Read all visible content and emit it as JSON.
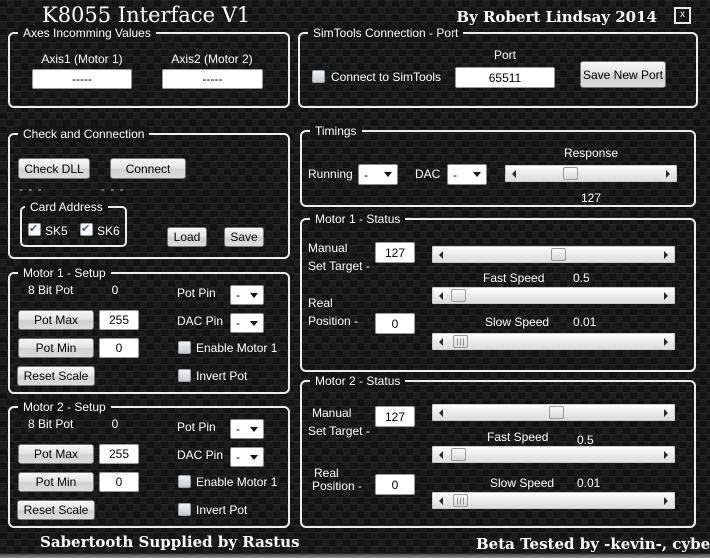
{
  "window": {
    "title": "K8055 Interface V1",
    "byline": "By Robert Lindsay 2014",
    "close": "x"
  },
  "axes": {
    "title": "Axes Incomming Values",
    "axis1_label": "Axis1 (Motor 1)",
    "axis1_value": "-----",
    "axis2_label": "Axis2 (Motor 2)",
    "axis2_value": "-----"
  },
  "simtools": {
    "title": "SimTools Connection - Port",
    "connect_label": "Connect to SimTools",
    "connect_checked": false,
    "port_label": "Port",
    "port_value": "65511",
    "save_button": "Save New Port"
  },
  "check": {
    "title": "Check and Connection",
    "check_dll_button": "Check DLL",
    "connect_button": "Connect",
    "status_left": "- - -",
    "status_right": "- - -",
    "card": {
      "title": "Card Address",
      "sk5_label": "SK5",
      "sk5_checked": true,
      "sk6_label": "SK6",
      "sk6_checked": true
    },
    "load_button": "Load",
    "save_button": "Save"
  },
  "timings": {
    "title": "Timings",
    "running_label": "Running",
    "running_value": "-",
    "dac_label": "DAC",
    "dac_value": "-",
    "response_label": "Response",
    "response_value": "127"
  },
  "motor1_setup": {
    "title": "Motor 1 - Setup",
    "bit_pot_label": "8 Bit Pot",
    "bit_pot_value": "0",
    "pot_pin_label": "Pot Pin",
    "pot_pin_value": "-",
    "pot_max_button": "Pot Max",
    "pot_max_value": "255",
    "dac_pin_label": "DAC Pin",
    "dac_pin_value": "-",
    "pot_min_button": "Pot Min",
    "pot_min_value": "0",
    "enable_label": "Enable Motor 1",
    "enable_checked": false,
    "reset_button": "Reset Scale",
    "invert_label": "Invert Pot",
    "invert_checked": false
  },
  "motor2_setup": {
    "title": "Motor 2 - Setup",
    "bit_pot_label": "8 Bit Pot",
    "bit_pot_value": "0",
    "pot_pin_label": "Pot Pin",
    "pot_pin_value": "-",
    "pot_max_button": "Pot Max",
    "pot_max_value": "255",
    "dac_pin_label": "DAC Pin",
    "dac_pin_value": "-",
    "pot_min_button": "Pot Min",
    "pot_min_value": "0",
    "enable_label": "Enable Motor 1",
    "enable_checked": false,
    "reset_button": "Reset Scale",
    "invert_label": "Invert Pot",
    "invert_checked": false
  },
  "motor1_status": {
    "title": "Motor 1 - Status",
    "manual_label_line1": "Manual",
    "manual_label_line2": "Set Target -",
    "manual_value": "127",
    "fast_speed_label": "Fast Speed",
    "fast_speed_value": "0.5",
    "real_label_line1": "Real",
    "real_label_line2": "Position -",
    "real_value": "0",
    "slow_speed_label": "Slow Speed",
    "slow_speed_value": "0.01"
  },
  "motor2_status": {
    "title": "Motor 2 - Status",
    "manual_label_line1": "Manual",
    "manual_label_line2": "Set Target -",
    "manual_value": "127",
    "fast_speed_label": "Fast Speed",
    "fast_speed_value": "0.5",
    "real_label_line1": "Real",
    "real_label_line2": "Position -",
    "real_value": "0",
    "slow_speed_label": "Slow Speed",
    "slow_speed_value": "0.01"
  },
  "footer": {
    "left": "Sabertooth Supplied by Rastus",
    "right": "Beta Tested by  -kevin-, cyberzu"
  },
  "icons": {
    "close": "x",
    "combo_arrow": "chevron-down",
    "scroll_left": "arrow-left",
    "scroll_right": "arrow-right",
    "checkmark": "✔"
  },
  "colors": {
    "background": "#141414",
    "panel_border": "#ececec",
    "text": "#ffffff",
    "checkmark_blue": "#3b5c8c",
    "button_face": "#e3e3e3"
  }
}
